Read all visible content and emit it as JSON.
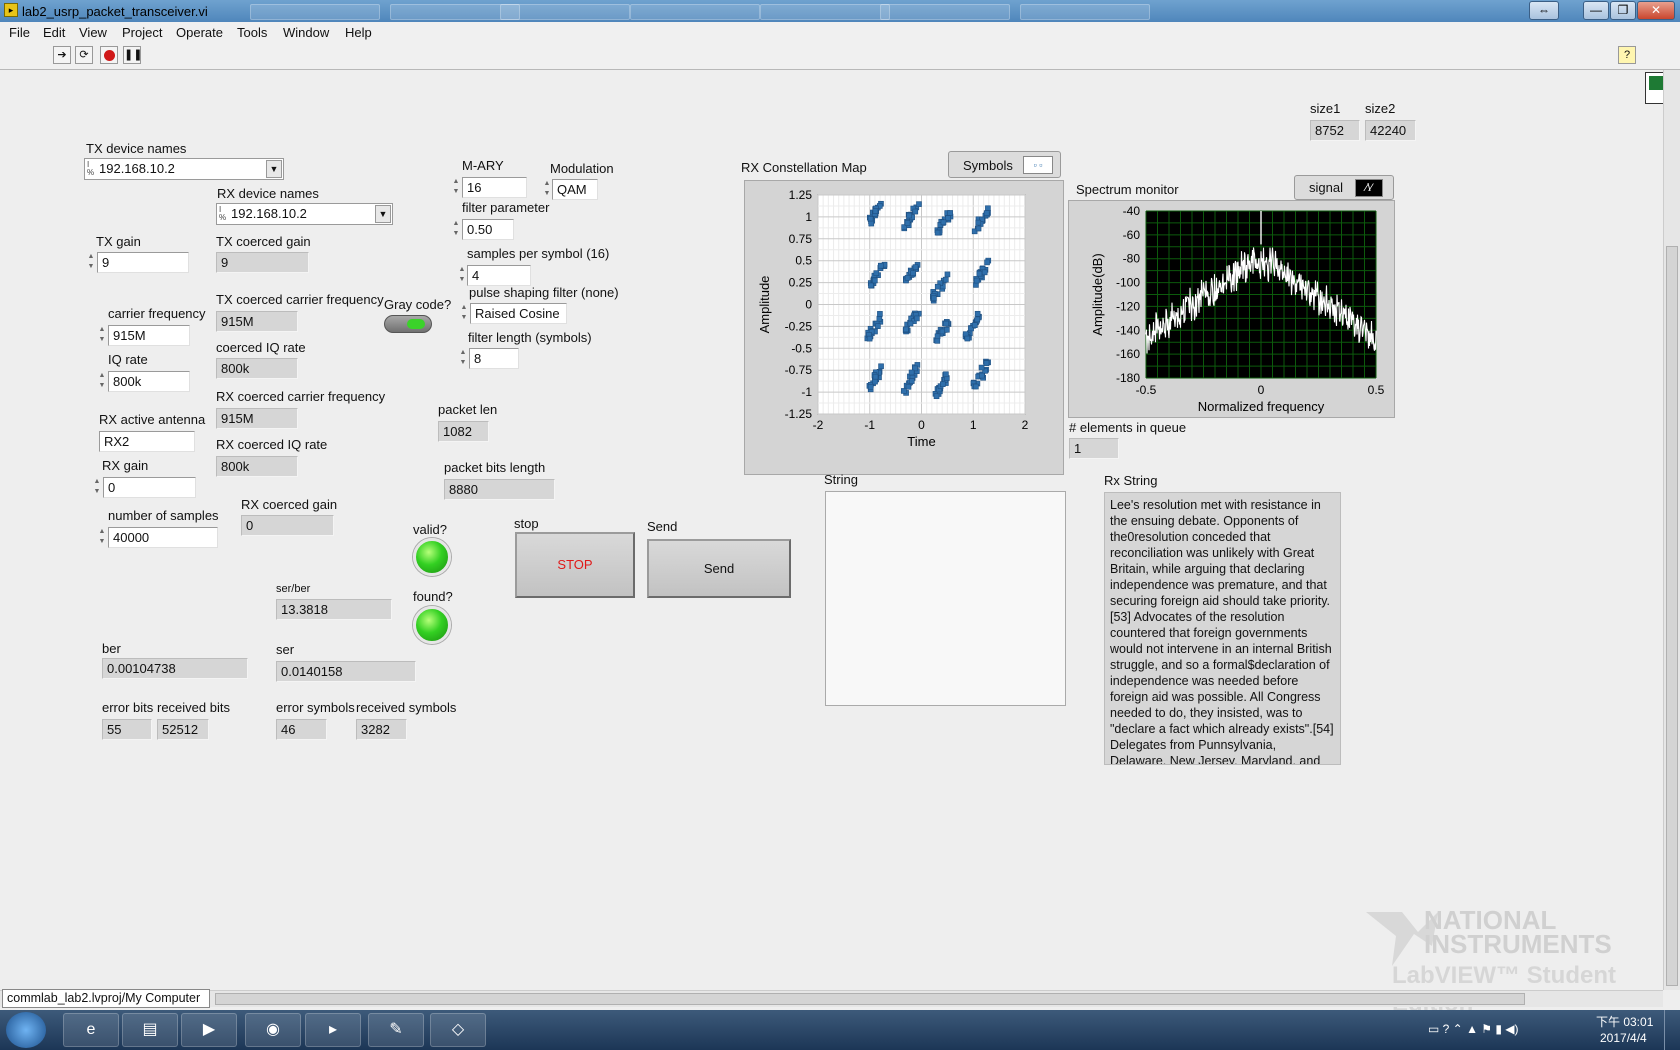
{
  "window": {
    "title": "lab2_usrp_packet_transceiver.vi",
    "buttons": [
      "⇔",
      "—",
      "❐",
      "✕"
    ]
  },
  "menu": [
    "File",
    "Edit",
    "View",
    "Project",
    "Operate",
    "Tools",
    "Window",
    "Help"
  ],
  "toolbar": {
    "help": "?"
  },
  "panel": {
    "tx_device_names_label": "TX device names",
    "tx_device_names_value": "192.168.10.2",
    "rx_device_names_label": "RX device names",
    "rx_device_names_value": "192.168.10.2",
    "tx_gain_label": "TX gain",
    "tx_gain_value": "9",
    "tx_coerced_gain_label": "TX coerced gain",
    "tx_coerced_gain_value": "9",
    "carrier_frequency_label": "carrier frequency",
    "carrier_frequency_value": "915M",
    "tx_coerced_carrier_frequency_label": "TX coerced carrier frequency",
    "tx_coerced_carrier_frequency_value": "915M",
    "iq_rate_label": "IQ rate",
    "iq_rate_value": "800k",
    "coerced_iq_rate_label": "coerced IQ rate",
    "coerced_iq_rate_value": "800k",
    "rx_active_antenna_label": "RX active antenna",
    "rx_active_antenna_value": "RX2",
    "rx_coerced_carrier_frequency_label": "RX coerced carrier frequency",
    "rx_coerced_carrier_frequency_value": "915M",
    "rx_gain_label": "RX gain",
    "rx_gain_value": "0",
    "rx_coerced_iq_rate_label": "RX coerced IQ rate",
    "rx_coerced_iq_rate_value": "800k",
    "rx_coerced_gain_label": "RX coerced gain",
    "rx_coerced_gain_value": "0",
    "number_of_samples_label": "number of samples",
    "number_of_samples_value": "40000",
    "gray_code_label": "Gray code?",
    "mary_label": "M-ARY",
    "mary_value": "16",
    "modulation_label": "Modulation",
    "modulation_value": "QAM",
    "filter_parameter_label": "filter parameter",
    "filter_parameter_value": "0.50",
    "samples_per_symbol_label": "samples per symbol (16)",
    "samples_per_symbol_value": "4",
    "pulse_shaping_label": "pulse shaping filter (none)",
    "pulse_shaping_value": "Raised Cosine",
    "filter_length_label": "filter length (symbols)",
    "filter_length_value": "8",
    "packet_len_label": "packet len",
    "packet_len_value": "1082",
    "packet_bits_length_label": "packet bits length",
    "packet_bits_length_value": "8880",
    "valid_label": "valid?",
    "found_label": "found?",
    "stop_label": "stop",
    "stop_button": "STOP",
    "send_label": "Send",
    "send_button": "Send",
    "ser_ber_label": "ser/ber",
    "ser_ber_value": "13.3818",
    "ber_label": "ber",
    "ber_value": "0.00104738",
    "ser_label": "ser",
    "ser_value": "0.0140158",
    "error_bits_label": "error bits",
    "error_bits_value": "55",
    "received_bits_label": "received bits",
    "received_bits_value": "52512",
    "error_symbols_label": "error symbols",
    "error_symbols_value": "46",
    "received_symbols_label": "received symbols",
    "received_symbols_value": "3282",
    "size1_label": "size1",
    "size1_value": "8752",
    "size2_label": "size2",
    "size2_value": "42240",
    "elements_in_queue_label": "# elements in queue",
    "elements_in_queue_value": "1",
    "string_label": "String",
    "string_value": "",
    "rx_string_label": "Rx String",
    "rx_string_value": "Lee's resolution met with resistance in the ensuing debate. Opponents of the0resolution conceded that reconciliation was unlikely with Great Britain, while arguing that declaring independence was premature, and that securing foreign aid should take priority.[53] Advocates of the resolution countered that foreign governments would not intervene in an internal British struggle, and so a formal$declaration of independence was needed before foreign aid was possible. All Congress needed to do, they insisted, was to \"declare a fact which already exists\".[54] Delegates from Punnsylvania, Delaware, New Jersey, Maryland, and New York"
  },
  "chart_data": [
    {
      "type": "scatter",
      "title": "RX Constellation Map",
      "legend": "Symbols",
      "xlabel": "Time",
      "ylabel": "Amplitude",
      "xlim": [
        -2,
        2
      ],
      "ylim": [
        -1.25,
        1.25
      ],
      "xticks": [
        "-2",
        "-1",
        "0",
        "1",
        "2"
      ],
      "yticks": [
        "1.25",
        "1",
        "0.75",
        "0.5",
        "0.25",
        "0",
        "-0.25",
        "-0.5",
        "-0.75",
        "-1",
        "-1.25"
      ],
      "grid": true,
      "clusters": [
        {
          "x": -0.9,
          "y": 1.05
        },
        {
          "x": -0.2,
          "y": 1.0
        },
        {
          "x": 0.45,
          "y": 0.95
        },
        {
          "x": 1.15,
          "y": 0.95
        },
        {
          "x": -0.85,
          "y": 0.35
        },
        {
          "x": -0.2,
          "y": 0.35
        },
        {
          "x": 0.35,
          "y": 0.2
        },
        {
          "x": 1.15,
          "y": 0.35
        },
        {
          "x": -0.9,
          "y": -0.25
        },
        {
          "x": -0.2,
          "y": -0.2
        },
        {
          "x": 0.4,
          "y": -0.3
        },
        {
          "x": 1.0,
          "y": -0.25
        },
        {
          "x": -0.9,
          "y": -0.85
        },
        {
          "x": -0.2,
          "y": -0.85
        },
        {
          "x": 0.4,
          "y": -0.9
        },
        {
          "x": 1.15,
          "y": -0.8
        }
      ]
    },
    {
      "type": "line",
      "title": "Spectrum monitor",
      "legend": "signal",
      "xlabel": "Normalized frequency",
      "ylabel": "Amplitude(dB)",
      "xlim": [
        -0.5,
        0.5
      ],
      "ylim": [
        -180,
        -40
      ],
      "xticks": [
        "-0.5",
        "0",
        "0.5"
      ],
      "yticks": [
        "-40",
        "-60",
        "-80",
        "-100",
        "-120",
        "-140",
        "-160",
        "-180"
      ],
      "grid": true,
      "envelope": [
        {
          "x": -0.5,
          "y": -140
        },
        {
          "x": -0.4,
          "y": -127
        },
        {
          "x": -0.3,
          "y": -112
        },
        {
          "x": -0.2,
          "y": -98
        },
        {
          "x": -0.1,
          "y": -84
        },
        {
          "x": -0.05,
          "y": -78
        },
        {
          "x": 0.0,
          "y": -75
        },
        {
          "x": 0.05,
          "y": -78
        },
        {
          "x": 0.1,
          "y": -84
        },
        {
          "x": 0.2,
          "y": -98
        },
        {
          "x": 0.3,
          "y": -112
        },
        {
          "x": 0.4,
          "y": -127
        },
        {
          "x": 0.5,
          "y": -140
        }
      ]
    }
  ],
  "status": {
    "path": "commlab_lab2.lvproj/My Computer"
  },
  "watermark": {
    "line1": "NATIONAL",
    "line2": "INSTRUMENTS",
    "line3": "LabVIEW™ Student Edition"
  },
  "taskbar": {
    "time": "下午 03:01",
    "date": "2017/4/4"
  }
}
